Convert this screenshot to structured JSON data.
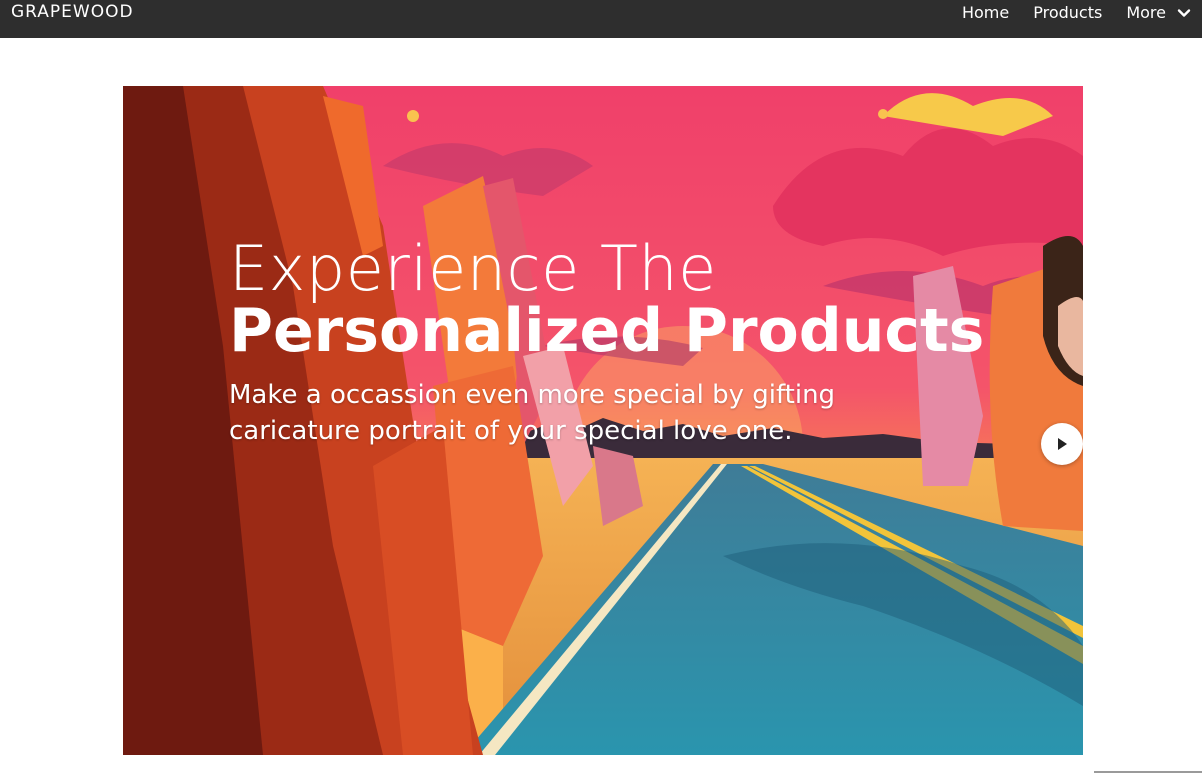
{
  "navbar": {
    "logo": "GRAPEWOOD",
    "links": {
      "home": "Home",
      "products": "Products",
      "more": "More"
    }
  },
  "hero": {
    "headline_line1": "Experience The",
    "headline_line2": "Personalized Products",
    "subtext": "Make a occassion even more special by gifting caricature portrait of your special love one."
  },
  "icons": {
    "more": "chevron-down-icon",
    "slider_next": "play-icon"
  }
}
